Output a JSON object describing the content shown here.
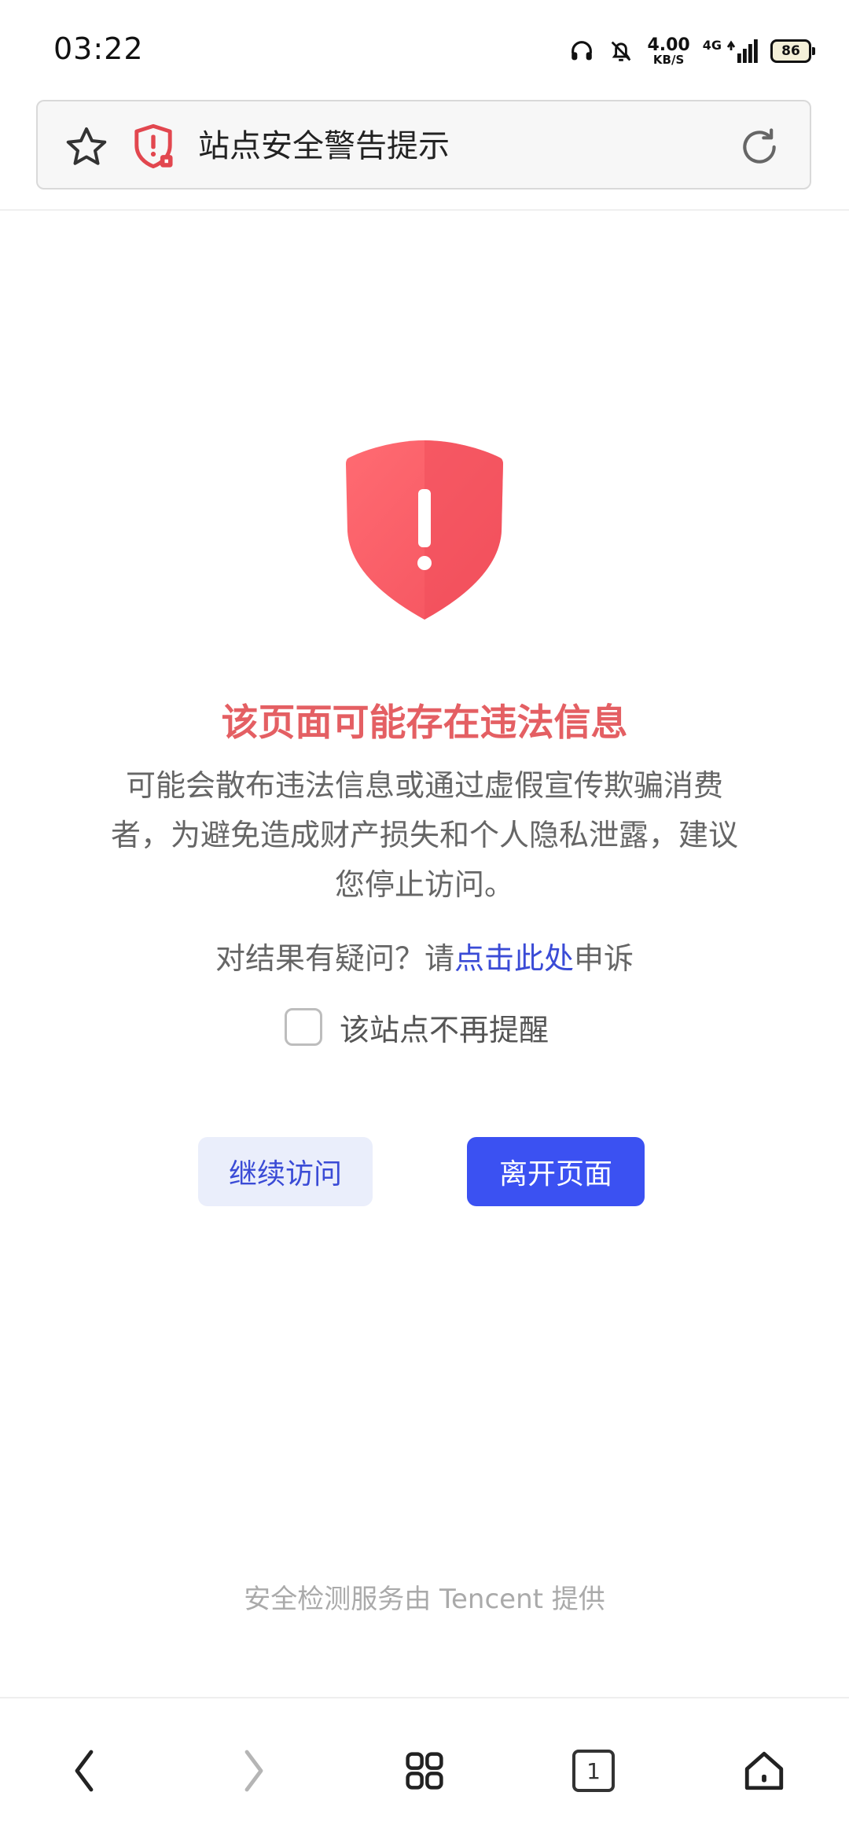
{
  "status_bar": {
    "time": "03:22",
    "net_speed_value": "4.00",
    "net_speed_unit": "KB/S",
    "network_type": "4G",
    "battery": "86",
    "icons": [
      "headphones-icon",
      "bell-off-icon",
      "signal-icon",
      "battery-icon"
    ]
  },
  "address_bar": {
    "title": "站点安全警告提示",
    "icons": [
      "star-icon",
      "security-shield-icon",
      "reload-icon"
    ]
  },
  "warning": {
    "heading": "该页面可能存在违法信息",
    "body": "可能会散布违法信息或通过虚假宣传欺骗消费者，为避免造成财产损失和个人隐私泄露，建议您停止访问。",
    "appeal_prefix": "对结果有疑问？请",
    "appeal_link": "点击此处",
    "appeal_suffix": "申诉",
    "no_remind_label": "该站点不再提醒"
  },
  "buttons": {
    "continue": "继续访问",
    "leave": "离开页面"
  },
  "footer_note": "安全检测服务由 Tencent 提供",
  "bottom_nav": {
    "tab_count": "1",
    "icons": [
      "back-icon",
      "forward-icon",
      "menu-grid-icon",
      "tabs-icon",
      "home-icon"
    ]
  },
  "colors": {
    "warning_red": "#e45f63",
    "primary_blue": "#3b51f2",
    "link_blue": "#3a4bd6"
  }
}
